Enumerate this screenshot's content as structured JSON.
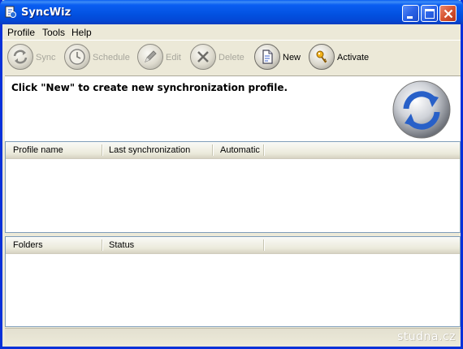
{
  "window": {
    "title": "SyncWiz"
  },
  "menu": {
    "profile": "Profile",
    "tools": "Tools",
    "help": "Help"
  },
  "toolbar": {
    "sync": "Sync",
    "schedule": "Schedule",
    "edit": "Edit",
    "delete": "Delete",
    "new": "New",
    "activate": "Activate"
  },
  "info": {
    "message": "Click \"New\" to create new synchronization profile."
  },
  "profiles_list": {
    "columns": [
      "Profile name",
      "Last synchronization",
      "Automatic"
    ]
  },
  "folders_list": {
    "columns": [
      "Folders",
      "Status"
    ]
  },
  "watermark": "studna.cz"
}
